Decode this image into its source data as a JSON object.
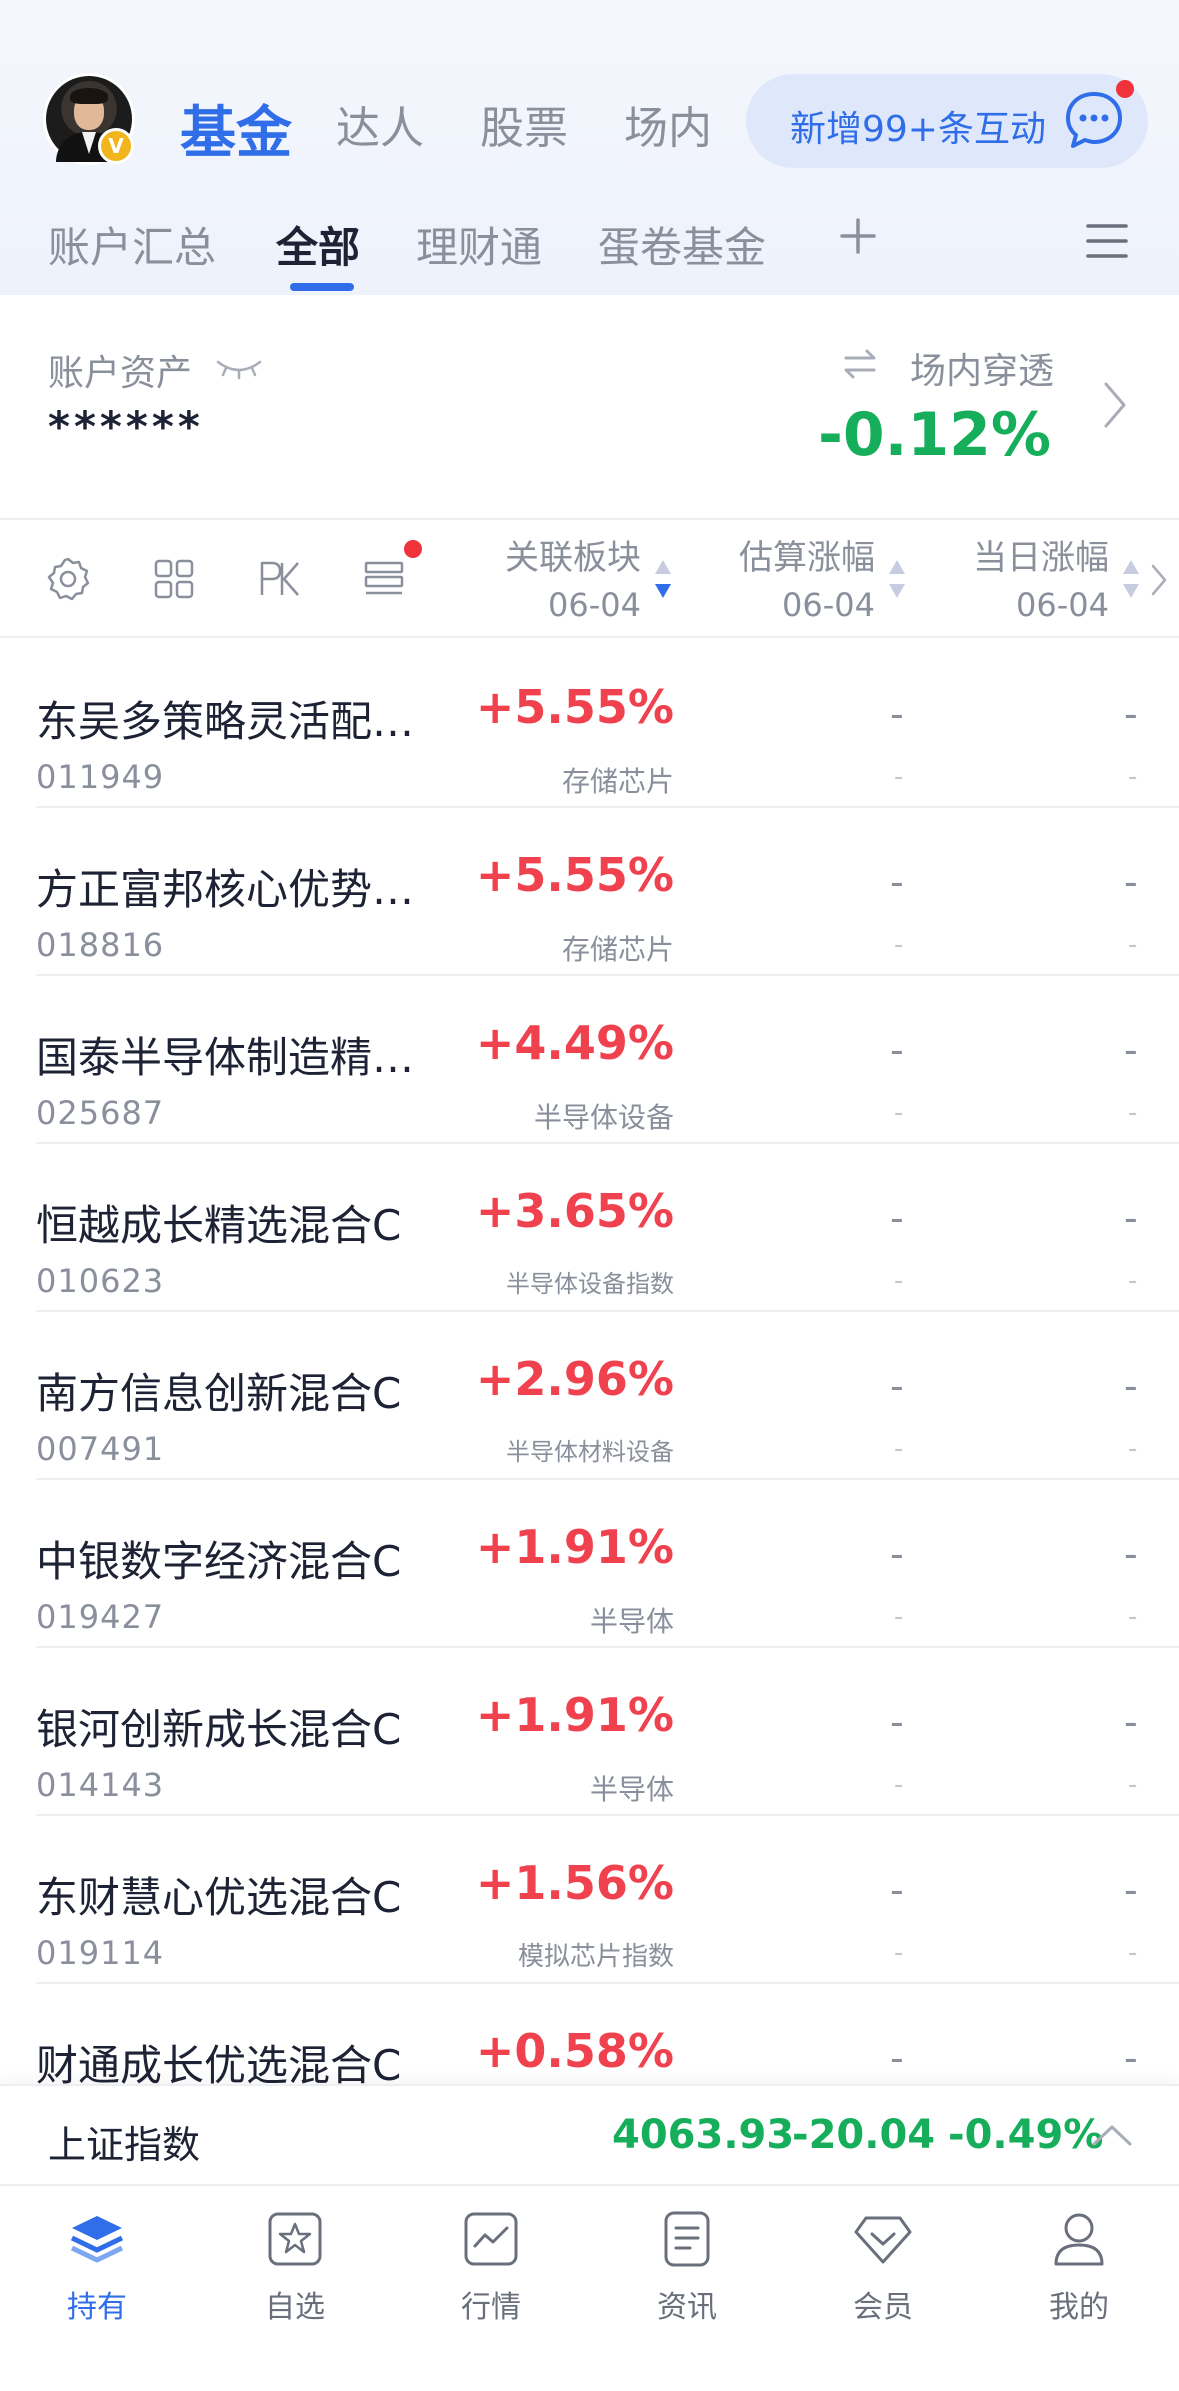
{
  "header": {
    "badge": "V",
    "main_tabs": [
      {
        "label": "基金",
        "active": true
      },
      {
        "label": "达人"
      },
      {
        "label": "股票"
      },
      {
        "label": "场内"
      }
    ],
    "interaction_pill": "新增99+条互动",
    "sub_tabs": [
      {
        "label": "账户汇总"
      },
      {
        "label": "全部",
        "active": true
      },
      {
        "label": "理财通"
      },
      {
        "label": "蛋卷基金"
      }
    ]
  },
  "asset": {
    "label": "账户资产",
    "value": "******",
    "penetration_label": "场内穿透",
    "penetration_value": "-0.12%"
  },
  "columns": [
    {
      "title": "关联板块",
      "date": "06-04"
    },
    {
      "title": "估算涨幅",
      "date": "06-04"
    },
    {
      "title": "当日涨幅",
      "date": "06-04"
    }
  ],
  "funds": [
    {
      "name": "东吴多策略灵活配…",
      "code": "011949",
      "change": "+5.55%",
      "sector": "存储芯片"
    },
    {
      "name": "方正富邦核心优势…",
      "code": "018816",
      "change": "+5.55%",
      "sector": "存储芯片"
    },
    {
      "name": "国泰半导体制造精…",
      "code": "025687",
      "change": "+4.49%",
      "sector": "半导体设备"
    },
    {
      "name": "恒越成长精选混合C",
      "code": "010623",
      "change": "+3.65%",
      "sector": "半导体设备指数"
    },
    {
      "name": "南方信息创新混合C",
      "code": "007491",
      "change": "+2.96%",
      "sector": "半导体材料设备"
    },
    {
      "name": "中银数字经济混合C",
      "code": "019427",
      "change": "+1.91%",
      "sector": "半导体"
    },
    {
      "name": "银河创新成长混合C",
      "code": "014143",
      "change": "+1.91%",
      "sector": "半导体"
    },
    {
      "name": "东财慧心优选混合C",
      "code": "019114",
      "change": "+1.56%",
      "sector": "模拟芯片指数"
    },
    {
      "name": "财通成长优选混合C",
      "code": "",
      "change": "+0.58%",
      "sector": ""
    }
  ],
  "placeholder_dash": "-",
  "index": {
    "name": "上证指数",
    "value": "4063.93",
    "change": "-20.04",
    "pct": "-0.49%"
  },
  "bottom_nav": [
    {
      "label": "持有",
      "active": true
    },
    {
      "label": "自选"
    },
    {
      "label": "行情"
    },
    {
      "label": "资讯"
    },
    {
      "label": "会员"
    },
    {
      "label": "我的"
    }
  ],
  "colors": {
    "accent": "#2f6ee8",
    "up": "#f0424e",
    "down": "#16ad5b",
    "muted": "#8a8f9c"
  }
}
